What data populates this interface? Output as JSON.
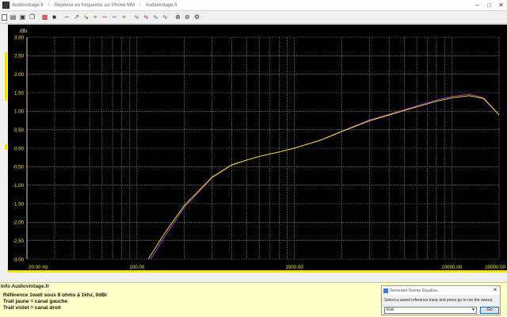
{
  "window": {
    "crumbs": [
      "Audiovintage.fr",
      "Réponse en fréquence sur Phono MM",
      "Audiovintage.fr"
    ],
    "minimize_icon": "minimize-icon",
    "maximize_icon": "maximize-icon",
    "close_icon": "close-icon"
  },
  "toolbar": {
    "icons": [
      "new-doc-icon",
      "open-folder-icon",
      "save-icon",
      "copy-icon",
      "print-icon",
      "generator-icon",
      "curve-icon",
      "curve-up-icon",
      "curve-down-icon",
      "curve-flat-icon",
      "curve-red-icon",
      "curve-blue-icon",
      "curve-compare-icon",
      "wave-icon",
      "wave-red-icon",
      "wave-blue-icon",
      "wave-green-icon",
      "zoom-in-icon",
      "zoom-out-icon",
      "settings-icon"
    ]
  },
  "chart_data": {
    "type": "line",
    "ylabel": "dBr",
    "yscale": "linear",
    "xscale": "log",
    "ylim": [
      -3.0,
      3.0
    ],
    "xlim": [
      20,
      20000
    ],
    "y_ticks": [
      "3.00",
      "2.50",
      "2.00",
      "1.50",
      "1.00",
      "0.50",
      "0.00",
      "-0.50",
      "-1.00",
      "-1.50",
      "-2.00",
      "-2.50",
      "-3.00"
    ],
    "x_tick_labels": [
      {
        "value": 20,
        "label": "20.00 Hz"
      },
      {
        "value": 100,
        "label": "100.00"
      },
      {
        "value": 1000,
        "label": "1000.00"
      },
      {
        "value": 10000,
        "label": "10000.00"
      },
      {
        "value": 20000,
        "label": "20000.00"
      }
    ],
    "grid": true,
    "series": [
      {
        "color": "#e0e000",
        "x": [
          118,
          150,
          200,
          300,
          400,
          500,
          600,
          800,
          1000,
          1500,
          2000,
          3000,
          5000,
          8000,
          10000,
          13000,
          16000,
          20000
        ],
        "y": [
          -3.0,
          -2.3,
          -1.55,
          -0.78,
          -0.45,
          -0.32,
          -0.22,
          -0.1,
          0.0,
          0.23,
          0.45,
          0.74,
          1.02,
          1.27,
          1.36,
          1.42,
          1.34,
          0.9
        ]
      },
      {
        "color": "#b030e0",
        "x": [
          122,
          155,
          200,
          300,
          400,
          500,
          600,
          800,
          1000,
          1500,
          2000,
          3000,
          5000,
          8000,
          10000,
          13000,
          16000,
          20000
        ],
        "y": [
          -3.0,
          -2.3,
          -1.6,
          -0.8,
          -0.46,
          -0.32,
          -0.22,
          -0.1,
          0.0,
          0.24,
          0.46,
          0.76,
          1.04,
          1.3,
          1.4,
          1.46,
          1.36,
          0.9
        ]
      }
    ]
  },
  "info": {
    "title": "Info Audiovintage.fr",
    "lines": [
      "Référence 1watt sous 8 ohms à 1khz, 0dBr",
      "Trait jaune = canal gauche",
      "Trait violet = canal droit"
    ]
  },
  "dialog": {
    "title": "Generator Sweep Equalisa...",
    "message": "Select a saved reference trace and press go to run the sweep",
    "selected": "Kiwi",
    "go": "Go"
  },
  "colors": {
    "plot_bg": "#000000",
    "grid": "#7a7a7a",
    "marker": "#f5e400",
    "left_channel": "#e0e000",
    "right_channel": "#b030e0"
  }
}
